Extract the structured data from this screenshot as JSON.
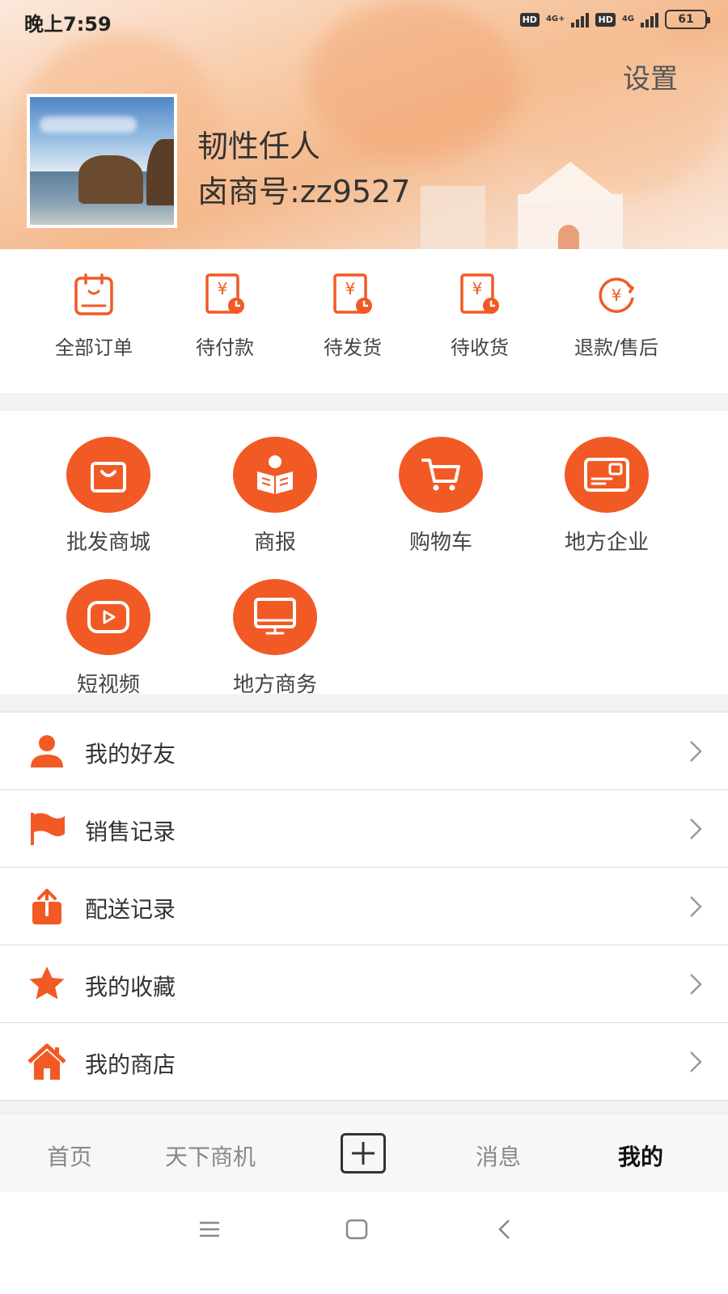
{
  "status_bar": {
    "time": "晚上7:59",
    "hd_1": "HD",
    "network_1": "4G+",
    "hd_2": "HD",
    "network_2": "4G",
    "battery": "61"
  },
  "header": {
    "settings_label": "设置",
    "user_name": "韧性任人",
    "merchant_id": "卤商号:zz9527"
  },
  "orders": [
    {
      "label": "全部订单",
      "icon": "clipboard-icon"
    },
    {
      "label": "待付款",
      "icon": "pending-payment-icon"
    },
    {
      "label": "待发货",
      "icon": "pending-shipment-icon"
    },
    {
      "label": "待收货",
      "icon": "pending-receipt-icon"
    },
    {
      "label": "退款/售后",
      "icon": "refund-icon"
    }
  ],
  "grid": [
    {
      "label": "批发商城",
      "icon": "shopping-bag-icon"
    },
    {
      "label": "商报",
      "icon": "reading-icon"
    },
    {
      "label": "购物车",
      "icon": "cart-icon"
    },
    {
      "label": "地方企业",
      "icon": "card-icon"
    },
    {
      "label": "短视频",
      "icon": "play-icon"
    },
    {
      "label": "地方商务",
      "icon": "monitor-icon"
    }
  ],
  "list": [
    {
      "label": "我的好友",
      "icon": "person-icon"
    },
    {
      "label": "销售记录",
      "icon": "flag-icon"
    },
    {
      "label": "配送记录",
      "icon": "upload-icon"
    },
    {
      "label": "我的收藏",
      "icon": "star-icon"
    },
    {
      "label": "我的商店",
      "icon": "home-icon"
    }
  ],
  "bottom_nav": {
    "home": "首页",
    "opportunities": "天下商机",
    "add_icon": "plus-icon",
    "messages": "消息",
    "mine": "我的"
  },
  "colors": {
    "accent": "#f15a24",
    "header_bg": "#f8cfae"
  }
}
